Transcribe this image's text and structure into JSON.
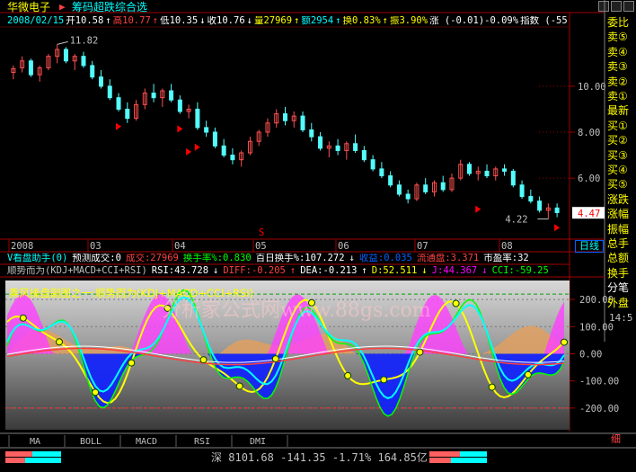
{
  "header": {
    "stock_name": "华微电子",
    "study_name": "筹码超跌综合选",
    "quote": [
      {
        "text": "2008/02/15",
        "color": "#00ffff"
      },
      {
        "text": "开10.58",
        "color": "#ffffff"
      },
      {
        "text": "↑",
        "color": "#ffffff"
      },
      {
        "text": "高10.77",
        "color": "#ff4040"
      },
      {
        "text": "↑",
        "color": "#ff4040"
      },
      {
        "text": "低10.35",
        "color": "#ffffff"
      },
      {
        "text": "↓",
        "color": "#ffffff"
      },
      {
        "text": "收10.76",
        "color": "#ffffff"
      },
      {
        "text": "↓",
        "color": "#ffffff"
      },
      {
        "text": "量27969",
        "color": "#ffff00"
      },
      {
        "text": "↑",
        "color": "#ffff00"
      },
      {
        "text": "额2954",
        "color": "#00ffff"
      },
      {
        "text": "↑",
        "color": "#00ffff"
      },
      {
        "text": "换0.83%",
        "color": "#ffff00"
      },
      {
        "text": "↑",
        "color": "#ffff00"
      },
      {
        "text": "振3.90%",
        "color": "#ffff00"
      },
      {
        "text": "涨 (-0.01)-0.09%",
        "color": "#ffffff"
      },
      {
        "text": "指数 (-55",
        "color": "#ffffff"
      }
    ]
  },
  "sidebar": {
    "items": [
      {
        "label": "委比",
        "color": "#ffff00"
      },
      {
        "label": "卖⑤",
        "color": "#ffff00"
      },
      {
        "label": "卖④",
        "color": "#ffff00"
      },
      {
        "label": "卖③",
        "color": "#ffff00"
      },
      {
        "label": "卖②",
        "color": "#ffff00"
      },
      {
        "label": "卖①",
        "color": "#ffff00"
      },
      {
        "label": "最新",
        "color": "#ffff00"
      },
      {
        "label": "买①",
        "color": "#ffff00"
      },
      {
        "label": "买②",
        "color": "#ffff00"
      },
      {
        "label": "买③",
        "color": "#ffff00"
      },
      {
        "label": "买④",
        "color": "#ffff00"
      },
      {
        "label": "买⑤",
        "color": "#ffff00"
      },
      {
        "label": "涨跌",
        "color": "#ffff00"
      },
      {
        "label": "涨幅",
        "color": "#ffff00"
      },
      {
        "label": "振幅",
        "color": "#ffff00"
      },
      {
        "label": "总手",
        "color": "#ffff00"
      },
      {
        "label": "总额",
        "color": "#ffff00"
      },
      {
        "label": "换手",
        "color": "#ffff00"
      },
      {
        "label": "分笔",
        "color": "#ffffff"
      },
      {
        "label": "外盘",
        "color": "#ffff00"
      }
    ],
    "time": "14:5",
    "daily_tab": "日线",
    "corner_label": "细"
  },
  "price_axis": {
    "ticks": [
      "10.00",
      "8.00",
      "6.00"
    ],
    "current": "4.47"
  },
  "annotations": {
    "high": "11.82",
    "low": "4.22",
    "signal": "S"
  },
  "date_axis": {
    "labels": [
      "2008",
      "03",
      "04",
      "05",
      "06",
      "07",
      "08"
    ]
  },
  "info_bar": [
    {
      "text": "V看盘助手(0)",
      "color": "#00ffff"
    },
    {
      "text": "预测成交:0",
      "color": "#ffffff"
    },
    {
      "text": "成交:27969",
      "color": "#ff4040"
    },
    {
      "text": "换手率%:0.830",
      "color": "#00ff00"
    },
    {
      "text": "百日换手%:107.272",
      "color": "#ffffff"
    },
    {
      "text": "↓",
      "color": "#ffffff"
    },
    {
      "text": "收益:0.035",
      "color": "#0060ff"
    },
    {
      "text": "流通盘:3.371",
      "color": "#ff4040"
    },
    {
      "text": "市盈率:32",
      "color": "#ffffff"
    }
  ],
  "indicator_bar": [
    {
      "text": "顺势而为(KDJ+MACD+CCI+RSI)",
      "color": "#c0c0c0"
    },
    {
      "text": "RSI:43.728",
      "color": "#ffffff"
    },
    {
      "text": "↓",
      "color": "#ffffff"
    },
    {
      "text": "DIFF:-0.205",
      "color": "#ff4040"
    },
    {
      "text": "↑",
      "color": "#ff4040"
    },
    {
      "text": "DEA:-0.213",
      "color": "#ffffff"
    },
    {
      "text": "↑",
      "color": "#ffffff"
    },
    {
      "text": "D:52.511",
      "color": "#ffff00"
    },
    {
      "text": "↓",
      "color": "#ffff00"
    },
    {
      "text": "J:44.367",
      "color": "#ff00ff"
    },
    {
      "text": "↓",
      "color": "#ff00ff"
    },
    {
      "text": "CCI:-59.25",
      "color": "#00ff00"
    }
  ],
  "sub_chart": {
    "title": "乘风操盘副图之一:顺势而为(KDJ+MACD+CCI+RSI)",
    "watermark": "分析家公式网www.88gs.com",
    "ticks": [
      "200.00",
      "100.00",
      "0.00",
      "-100.00",
      "-200.00"
    ]
  },
  "bottom_tabs": [
    "MA",
    "BOLL",
    "MACD",
    "RSI",
    "DMI"
  ],
  "status_bar": {
    "index_name": "深",
    "value": "8101.68",
    "change": "-141.35",
    "percent": "-1.71%",
    "amount": "164.85亿"
  },
  "chart_data": {
    "type": "candlestick",
    "x_labels": [
      "2008",
      "03",
      "04",
      "05",
      "06",
      "07",
      "08"
    ],
    "ylim": [
      3.5,
      12.5
    ],
    "ohlc": [
      [
        10.6,
        10.9,
        10.3,
        10.76
      ],
      [
        10.8,
        11.3,
        10.6,
        11.1
      ],
      [
        11.1,
        11.2,
        10.4,
        10.5
      ],
      [
        10.5,
        10.9,
        10.2,
        10.8
      ],
      [
        10.8,
        11.4,
        10.7,
        11.3
      ],
      [
        11.3,
        11.82,
        11.0,
        11.6
      ],
      [
        11.6,
        11.7,
        11.0,
        11.1
      ],
      [
        11.1,
        11.4,
        10.7,
        11.3
      ],
      [
        11.3,
        11.5,
        10.8,
        10.9
      ],
      [
        10.9,
        11.1,
        10.3,
        10.4
      ],
      [
        10.4,
        10.7,
        9.9,
        10.0
      ],
      [
        10.0,
        10.3,
        9.4,
        9.5
      ],
      [
        9.5,
        9.7,
        8.9,
        9.0
      ],
      [
        9.0,
        9.3,
        8.4,
        8.6
      ],
      [
        8.6,
        9.4,
        8.5,
        9.2
      ],
      [
        9.2,
        9.9,
        9.0,
        9.7
      ],
      [
        9.7,
        10.1,
        9.3,
        9.5
      ],
      [
        9.5,
        9.9,
        9.1,
        9.8
      ],
      [
        9.8,
        10.1,
        9.3,
        9.4
      ],
      [
        9.4,
        9.6,
        8.8,
        8.9
      ],
      [
        8.9,
        9.2,
        8.6,
        9.0
      ],
      [
        9.0,
        9.3,
        8.1,
        8.2
      ],
      [
        8.2,
        8.5,
        7.8,
        8.0
      ],
      [
        8.0,
        8.2,
        7.3,
        7.4
      ],
      [
        7.4,
        7.7,
        6.9,
        7.0
      ],
      [
        7.0,
        7.3,
        6.6,
        6.8
      ],
      [
        6.8,
        7.2,
        6.5,
        7.1
      ],
      [
        7.1,
        7.8,
        7.0,
        7.6
      ],
      [
        7.6,
        8.1,
        7.4,
        8.0
      ],
      [
        8.0,
        8.6,
        7.8,
        8.4
      ],
      [
        8.4,
        9.0,
        8.2,
        8.8
      ],
      [
        8.8,
        9.1,
        8.3,
        8.5
      ],
      [
        8.5,
        8.9,
        8.2,
        8.7
      ],
      [
        8.7,
        8.9,
        8.0,
        8.1
      ],
      [
        8.1,
        8.4,
        7.6,
        7.8
      ],
      [
        7.8,
        8.0,
        7.2,
        7.3
      ],
      [
        7.3,
        7.6,
        6.9,
        7.4
      ],
      [
        7.4,
        7.7,
        7.0,
        7.2
      ],
      [
        7.2,
        7.6,
        6.8,
        7.5
      ],
      [
        7.5,
        7.9,
        7.1,
        7.2
      ],
      [
        7.2,
        7.4,
        6.7,
        6.8
      ],
      [
        6.8,
        7.0,
        6.3,
        6.4
      ],
      [
        6.4,
        6.7,
        6.0,
        6.1
      ],
      [
        6.1,
        6.3,
        5.6,
        5.7
      ],
      [
        5.7,
        5.9,
        5.2,
        5.3
      ],
      [
        5.3,
        5.5,
        4.9,
        5.1
      ],
      [
        5.1,
        5.8,
        5.0,
        5.7
      ],
      [
        5.7,
        6.0,
        5.3,
        5.4
      ],
      [
        5.4,
        5.9,
        5.2,
        5.8
      ],
      [
        5.8,
        6.1,
        5.4,
        5.5
      ],
      [
        5.5,
        6.2,
        5.4,
        6.0
      ],
      [
        6.0,
        6.8,
        5.9,
        6.6
      ],
      [
        6.6,
        6.7,
        6.1,
        6.2
      ],
      [
        6.2,
        6.5,
        5.9,
        6.3
      ],
      [
        6.3,
        6.6,
        6.0,
        6.1
      ],
      [
        6.1,
        6.5,
        5.9,
        6.4
      ],
      [
        6.4,
        6.6,
        6.1,
        6.3
      ],
      [
        6.3,
        6.4,
        5.6,
        5.7
      ],
      [
        5.7,
        5.9,
        5.1,
        5.2
      ],
      [
        5.2,
        5.5,
        4.9,
        5.0
      ],
      [
        5.0,
        5.2,
        4.5,
        4.6
      ],
      [
        4.6,
        4.9,
        4.22,
        4.7
      ],
      [
        4.7,
        4.9,
        4.3,
        4.5
      ]
    ]
  }
}
